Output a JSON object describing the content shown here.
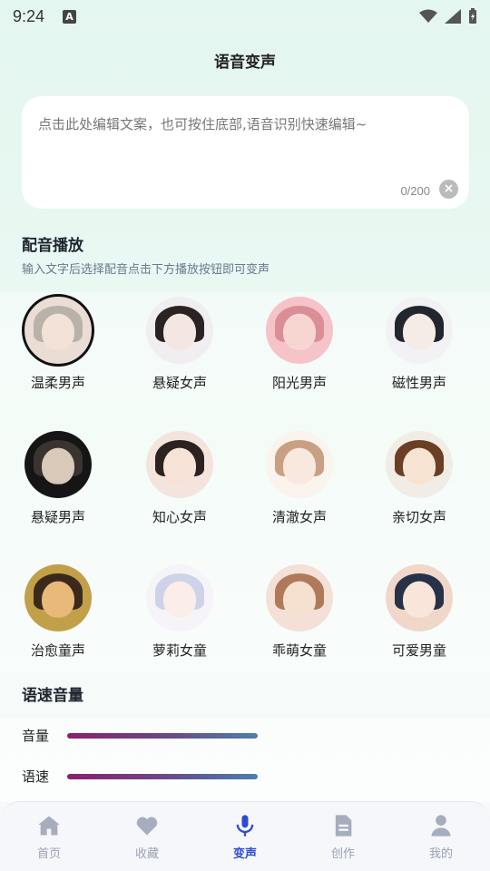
{
  "status_bar": {
    "time": "9:24",
    "a_icon": "A"
  },
  "page_title": "语音变声",
  "editor": {
    "placeholder": "点击此处编辑文案，也可按住底部,语音识别快速编辑~",
    "counter": "0/200"
  },
  "dubbing": {
    "title": "配音播放",
    "subtitle": "输入文字后选择配音点击下方播放按钮即可变声",
    "voices": [
      {
        "label": "温柔男声",
        "selected": true,
        "bg": "#e9ddd6",
        "hair": "#b9b2a8",
        "skin": "#f3e2d8"
      },
      {
        "label": "悬疑女声",
        "selected": false,
        "bg": "#f0eef0",
        "hair": "#2a2323",
        "skin": "#f4e6e2"
      },
      {
        "label": "阳光男声",
        "selected": false,
        "bg": "#f5c3c8",
        "hair": "#d98f95",
        "skin": "#f7d6d2"
      },
      {
        "label": "磁性男声",
        "selected": false,
        "bg": "#f2f2f4",
        "hair": "#22262e",
        "skin": "#f6ece6"
      },
      {
        "label": "悬疑男声",
        "selected": false,
        "bg": "#151515",
        "hair": "#3a3330",
        "skin": "#d8c9b8"
      },
      {
        "label": "知心女声",
        "selected": false,
        "bg": "#f3e4dd",
        "hair": "#2c2220",
        "skin": "#f6e2d6"
      },
      {
        "label": "清澈女声",
        "selected": false,
        "bg": "#faf3ee",
        "hair": "#c9a083",
        "skin": "#f9e8de"
      },
      {
        "label": "亲切女声",
        "selected": false,
        "bg": "#f1ece6",
        "hair": "#6a3f26",
        "skin": "#f7e3d2"
      },
      {
        "label": "治愈童声",
        "selected": false,
        "bg": "#c2a04a",
        "hair": "#3b2a1c",
        "skin": "#e8b97a"
      },
      {
        "label": "萝莉女童",
        "selected": false,
        "bg": "#f5f4f8",
        "hair": "#cfd3e8",
        "skin": "#fbeee8"
      },
      {
        "label": "乖萌女童",
        "selected": false,
        "bg": "#f4e0d6",
        "hair": "#b07a5a",
        "skin": "#f6e0cf"
      },
      {
        "label": "可爱男童",
        "selected": false,
        "bg": "#f1d7c9",
        "hair": "#273147",
        "skin": "#f8e6da"
      }
    ]
  },
  "speed_volume": {
    "title": "语速音量",
    "volume_label": "音量",
    "speed_label": "语速"
  },
  "tabs": [
    {
      "label": "首页",
      "icon": "home-icon",
      "active": false
    },
    {
      "label": "收藏",
      "icon": "heart-icon",
      "active": false
    },
    {
      "label": "变声",
      "icon": "microphone-icon",
      "active": true
    },
    {
      "label": "创作",
      "icon": "document-icon",
      "active": false
    },
    {
      "label": "我的",
      "icon": "user-icon",
      "active": false
    }
  ],
  "colors": {
    "accent": "#2e4bd0",
    "inactive_tab": "#9aa1b3",
    "slider_start": "#8d1f6b",
    "slider_end": "#4a7fb0"
  }
}
